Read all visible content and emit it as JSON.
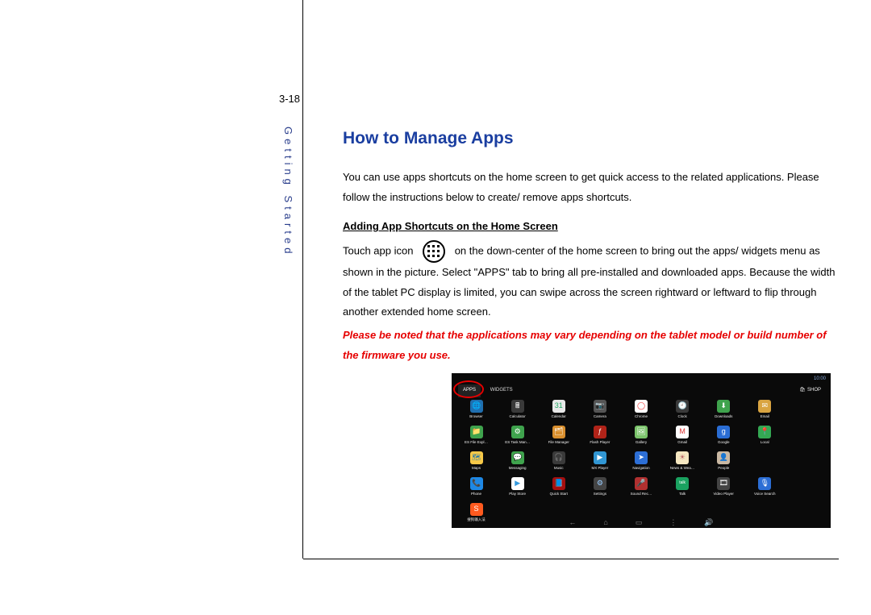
{
  "page_number": "3-18",
  "side_tab": "Getting Started",
  "heading": "How to Manage Apps",
  "intro": "You can use apps shortcuts on the home screen to get quick access to the related applications. Please follow the instructions below to create/ remove apps shortcuts.",
  "subheading": "Adding App Shortcuts on the Home Screen",
  "p2a": "Touch app icon",
  "p2b": "on the down-center of the home screen to bring out the apps/ widgets menu as shown in the picture. Select \"APPS\" tab to bring all pre-installed and downloaded apps. Because the width of the tablet PC display is limited, you can swipe across the screen rightward or leftward to flip through another extended home screen.",
  "note": "Please be noted that the applications may vary depending on the tablet model or build number of the firmware you use.",
  "tablet": {
    "status_time": "10:00",
    "tabs": {
      "apps": "APPS",
      "widgets": "WIDGETS"
    },
    "shop": "SHOP",
    "apps": [
      {
        "label": "Browser",
        "bg": "#1f6fb0",
        "fg": "#fff",
        "glyph": "🌐"
      },
      {
        "label": "Calculator",
        "bg": "#3a3a3a",
        "fg": "#fff",
        "glyph": "🖩"
      },
      {
        "label": "Calendar",
        "bg": "#e8e8e8",
        "fg": "#2a6",
        "glyph": "31"
      },
      {
        "label": "Camera",
        "bg": "#555",
        "fg": "#fff",
        "glyph": "📷"
      },
      {
        "label": "Chrome",
        "bg": "#fff",
        "fg": "#e33",
        "glyph": "◯"
      },
      {
        "label": "Clock",
        "bg": "#3a3a3a",
        "fg": "#fff",
        "glyph": "🕘"
      },
      {
        "label": "Downloads",
        "bg": "#3fa34d",
        "fg": "#fff",
        "glyph": "⬇"
      },
      {
        "label": "Email",
        "bg": "#d9a441",
        "fg": "#fff",
        "glyph": "✉"
      },
      {
        "label": "",
        "bg": "transparent",
        "fg": "#000",
        "glyph": ""
      },
      {
        "label": "ES File Expl…",
        "bg": "#3fa34d",
        "fg": "#fff",
        "glyph": "📁"
      },
      {
        "label": "ES Task Man…",
        "bg": "#3fa34d",
        "fg": "#fff",
        "glyph": "⚙"
      },
      {
        "label": "File Manager",
        "bg": "#d98f2e",
        "fg": "#fff",
        "glyph": "🗂"
      },
      {
        "label": "Flash Player",
        "bg": "#b02318",
        "fg": "#fff",
        "glyph": "ƒ"
      },
      {
        "label": "Gallery",
        "bg": "#7ac36a",
        "fg": "#fff",
        "glyph": "🖼"
      },
      {
        "label": "Gmail",
        "bg": "#fff",
        "fg": "#d33",
        "glyph": "M"
      },
      {
        "label": "Google",
        "bg": "#2a6dd4",
        "fg": "#fff",
        "glyph": "g"
      },
      {
        "label": "Local",
        "bg": "#34a853",
        "fg": "#b22",
        "glyph": "📍"
      },
      {
        "label": "",
        "bg": "transparent",
        "fg": "#000",
        "glyph": ""
      },
      {
        "label": "Maps",
        "bg": "#f7c948",
        "fg": "#27a",
        "glyph": "🗺"
      },
      {
        "label": "Messaging",
        "bg": "#3fa34d",
        "fg": "#fff",
        "glyph": "💬"
      },
      {
        "label": "Music",
        "bg": "#3a3a3a",
        "fg": "#ff8",
        "glyph": "🎧"
      },
      {
        "label": "MX Player",
        "bg": "#3196d3",
        "fg": "#fff",
        "glyph": "▶"
      },
      {
        "label": "Navigation",
        "bg": "#2c6ed5",
        "fg": "#fff",
        "glyph": "➤"
      },
      {
        "label": "News & Wea…",
        "bg": "#f5e7c1",
        "fg": "#b66",
        "glyph": "☀"
      },
      {
        "label": "People",
        "bg": "#c9b8a3",
        "fg": "#8a7",
        "glyph": "👤"
      },
      {
        "label": "",
        "bg": "transparent",
        "fg": "#000",
        "glyph": ""
      },
      {
        "label": "",
        "bg": "transparent",
        "fg": "#000",
        "glyph": ""
      },
      {
        "label": "Phone",
        "bg": "#1e88e5",
        "fg": "#fff",
        "glyph": "📞"
      },
      {
        "label": "Play Store",
        "bg": "#fff",
        "fg": "#39d",
        "glyph": "▶"
      },
      {
        "label": "Quick Start",
        "bg": "#a50f0f",
        "fg": "#fff",
        "glyph": "📘"
      },
      {
        "label": "Settings",
        "bg": "#444",
        "fg": "#9cf",
        "glyph": "⚙"
      },
      {
        "label": "Sound Rec…",
        "bg": "#b03030",
        "fg": "#fff",
        "glyph": "🎤"
      },
      {
        "label": "Talk",
        "bg": "#1aa260",
        "fg": "#fff",
        "glyph": "talk"
      },
      {
        "label": "Video Player",
        "bg": "#444",
        "fg": "#fff",
        "glyph": "🎞"
      },
      {
        "label": "Voice Search",
        "bg": "#2c6ed5",
        "fg": "#fff",
        "glyph": "🎙"
      },
      {
        "label": "",
        "bg": "transparent",
        "fg": "#000",
        "glyph": ""
      },
      {
        "label": "搜狗输入法",
        "bg": "#ff5a1f",
        "fg": "#fff",
        "glyph": "S"
      },
      {
        "label": "",
        "bg": "transparent",
        "fg": "",
        "glyph": ""
      },
      {
        "label": "",
        "bg": "transparent",
        "fg": "",
        "glyph": ""
      },
      {
        "label": "",
        "bg": "transparent",
        "fg": "",
        "glyph": ""
      },
      {
        "label": "",
        "bg": "transparent",
        "fg": "",
        "glyph": ""
      },
      {
        "label": "",
        "bg": "transparent",
        "fg": "",
        "glyph": ""
      },
      {
        "label": "",
        "bg": "transparent",
        "fg": "",
        "glyph": ""
      },
      {
        "label": "",
        "bg": "transparent",
        "fg": "",
        "glyph": ""
      },
      {
        "label": "",
        "bg": "transparent",
        "fg": "",
        "glyph": ""
      }
    ],
    "nav": [
      "←",
      "⌂",
      "▭",
      "⋮",
      "🔊"
    ]
  }
}
